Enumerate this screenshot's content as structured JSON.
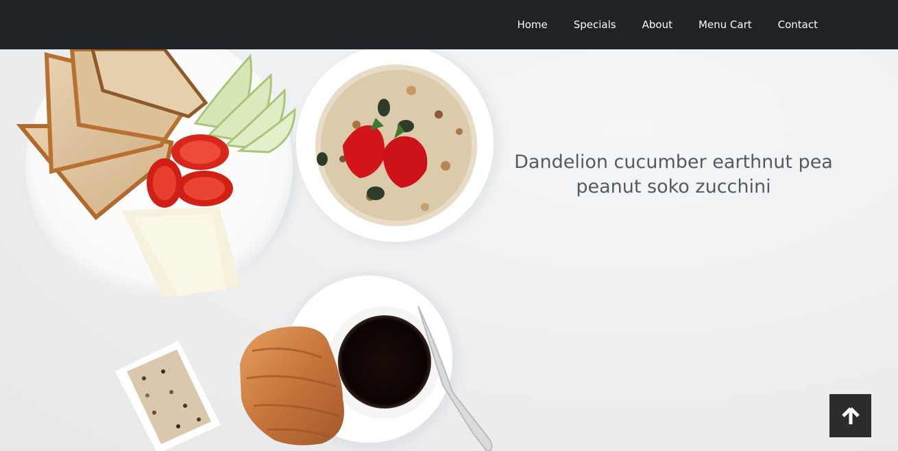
{
  "nav": {
    "items": [
      {
        "label": "Home"
      },
      {
        "label": "Specials"
      },
      {
        "label": "About"
      },
      {
        "label": "Menu Cart"
      },
      {
        "label": "Contact"
      }
    ]
  },
  "hero": {
    "headline": "Dandelion cucumber earthnut pea peanut soko zucchini",
    "image_subject": "breakfast-table-flatlay"
  },
  "scroll_top": {
    "icon": "arrow-up-icon"
  },
  "colors": {
    "navbar_bg": "#1f2226",
    "nav_text": "#ffffff",
    "headline_text": "#555a5f",
    "scroll_button_bg": "#2b2c2e"
  }
}
